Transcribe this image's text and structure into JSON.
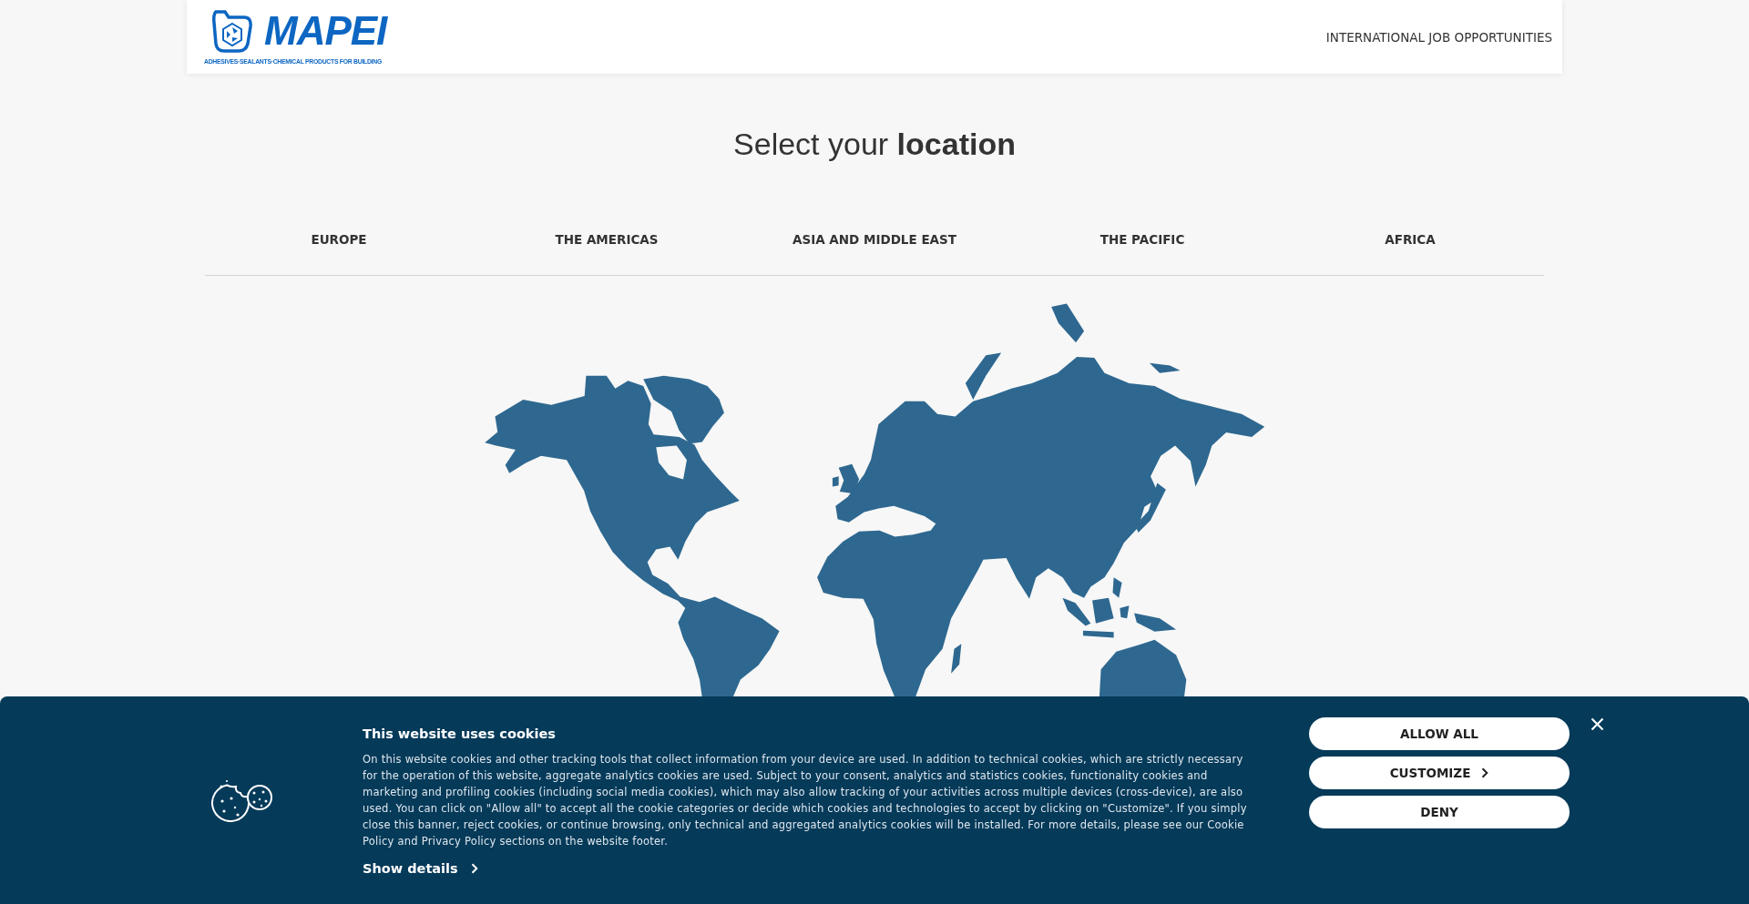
{
  "header": {
    "logo": {
      "wordmark": "MAPEI",
      "tagline": "ADHESIVES·SEALANTS·CHEMICAL PRODUCTS FOR BUILDING"
    },
    "nav_link": "INTERNATIONAL JOB OPPORTUNITIES"
  },
  "title": "Select your **location**",
  "region_tabs": [
    "EUROPE",
    "THE AMERICAS",
    "ASIA AND MIDDLE EAST",
    "THE PACIFIC",
    "AFRICA"
  ],
  "cookie_banner": {
    "title": "This website uses cookies",
    "text": "On this website cookies and other tracking tools that collect information from your device are used. In addition to technical cookies, which are strictly necessary for the operation of this website, aggregate analytics cookies are used. Subject to your consent, analytics and statistics cookies, functionality cookies and marketing and profiling cookies (including social media cookies), which may also allow tracking of your activities across multiple devices (cross-device), are also used. You can click on \"Allow all\" to accept all the cookie categories or decide which cookies and technologies to accept by clicking on \"Customize\". If you simply close this banner, reject cookies, or continue browsing, only technical and aggregated analytics cookies will be installed. For more details, please see our Cookie Policy and Privacy Policy sections on the website footer.",
    "show_details": "Show details",
    "buttons": [
      {
        "label": "ALLOW ALL",
        "kind": "plain"
      },
      {
        "label": "CUSTOMIZE",
        "kind": "submenu"
      },
      {
        "label": "DENY",
        "kind": "plain"
      }
    ]
  }
}
